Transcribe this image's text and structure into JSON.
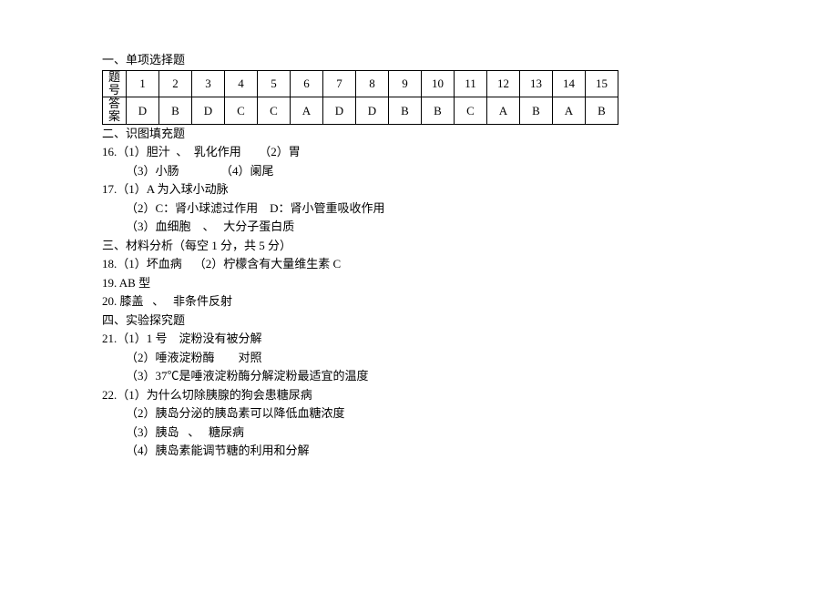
{
  "sections": {
    "s1_heading": "一、单项选择题",
    "s2_heading": "二、识图填充题",
    "s3_heading": "三、材料分析（每空 1 分，共 5 分）",
    "s4_heading": "四、实验探究题"
  },
  "answer_table": {
    "row1_label": "题号",
    "row2_label": "答案",
    "numbers": [
      "1",
      "2",
      "3",
      "4",
      "5",
      "6",
      "7",
      "8",
      "9",
      "10",
      "11",
      "12",
      "13",
      "14",
      "15"
    ],
    "answers": [
      "D",
      "B",
      "D",
      "C",
      "C",
      "A",
      "D",
      "D",
      "B",
      "B",
      "C",
      "A",
      "B",
      "A",
      "B"
    ]
  },
  "q16": {
    "line1": "16.（1）胆汁  、  乳化作用      （2）胃",
    "line2": "（3）小肠              （4）阑尾"
  },
  "q17": {
    "line1": "17.（1）A 为入球小动脉",
    "line2": "（2）C：肾小球滤过作用    D：肾小管重吸收作用",
    "line3": "（3）血细胞    、   大分子蛋白质"
  },
  "q18": {
    "line1": "18.（1）坏血病    （2）柠檬含有大量维生素 C"
  },
  "q19": {
    "line1": "19. AB 型"
  },
  "q20": {
    "line1": "20. 膝盖   、   非条件反射"
  },
  "q21": {
    "line1": "21.（1）1 号    淀粉没有被分解",
    "line2": "（2）唾液淀粉酶        对照",
    "line3": "（3）37℃是唾液淀粉酶分解淀粉最适宜的温度"
  },
  "q22": {
    "line1": "22.（1）为什么切除胰腺的狗会患糖尿病",
    "line2": "（2）胰岛分泌的胰岛素可以降低血糖浓度",
    "line3": "（3）胰岛   、   糖尿病",
    "line4": "（4）胰岛素能调节糖的利用和分解"
  },
  "chart_data": {
    "type": "table",
    "title": "单项选择题答案",
    "columns": [
      "题号",
      "答案"
    ],
    "rows": [
      [
        "1",
        "D"
      ],
      [
        "2",
        "B"
      ],
      [
        "3",
        "D"
      ],
      [
        "4",
        "C"
      ],
      [
        "5",
        "C"
      ],
      [
        "6",
        "A"
      ],
      [
        "7",
        "D"
      ],
      [
        "8",
        "D"
      ],
      [
        "9",
        "B"
      ],
      [
        "10",
        "B"
      ],
      [
        "11",
        "C"
      ],
      [
        "12",
        "A"
      ],
      [
        "13",
        "B"
      ],
      [
        "14",
        "A"
      ],
      [
        "15",
        "B"
      ]
    ]
  }
}
